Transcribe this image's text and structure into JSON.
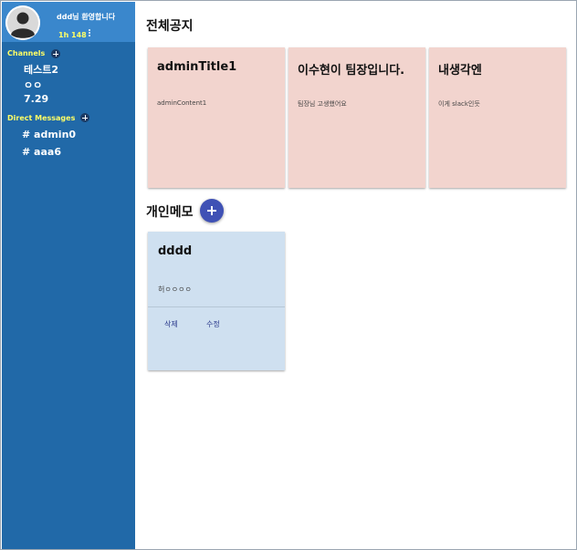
{
  "sidebar": {
    "profile": {
      "welcome": "ddd님 환영합니다",
      "timer": "1h 148",
      "avatar_icon": "user-avatar-icon",
      "menu_icon": "kebab-menu-icon"
    },
    "channels": {
      "header": "Channels",
      "add_icon": "add-circle-icon",
      "items": [
        {
          "label": "테스트2"
        },
        {
          "label": "ㅇㅇ"
        },
        {
          "label": "7.29"
        }
      ]
    },
    "direct_messages": {
      "header": "Direct Messages",
      "add_icon": "add-circle-icon",
      "items": [
        {
          "label": "# admin0"
        },
        {
          "label": "# aaa6"
        }
      ]
    }
  },
  "main": {
    "notice_heading": "전체공지",
    "notices": [
      {
        "title": "adminTitle1",
        "content": "adminContent1"
      },
      {
        "title": "이수현이 팀장입니다.",
        "content": "팀장님 고생했어요"
      },
      {
        "title": "내생각엔",
        "content": "이게 slack인듯"
      }
    ],
    "memo_heading": "개인메모",
    "add_memo_icon": "plus-icon",
    "memos": [
      {
        "title": "dddd",
        "content": "허ㅇㅇㅇㅇ",
        "delete_label": "삭제",
        "edit_label": "수정"
      }
    ]
  },
  "colors": {
    "sidebar": "#2169a8",
    "profile_bar": "#3a87cc",
    "highlight_text": "#ffff66",
    "notice_card": "#f2d4ce",
    "memo_card": "#cfe0f0",
    "fab": "#3f51b5"
  }
}
